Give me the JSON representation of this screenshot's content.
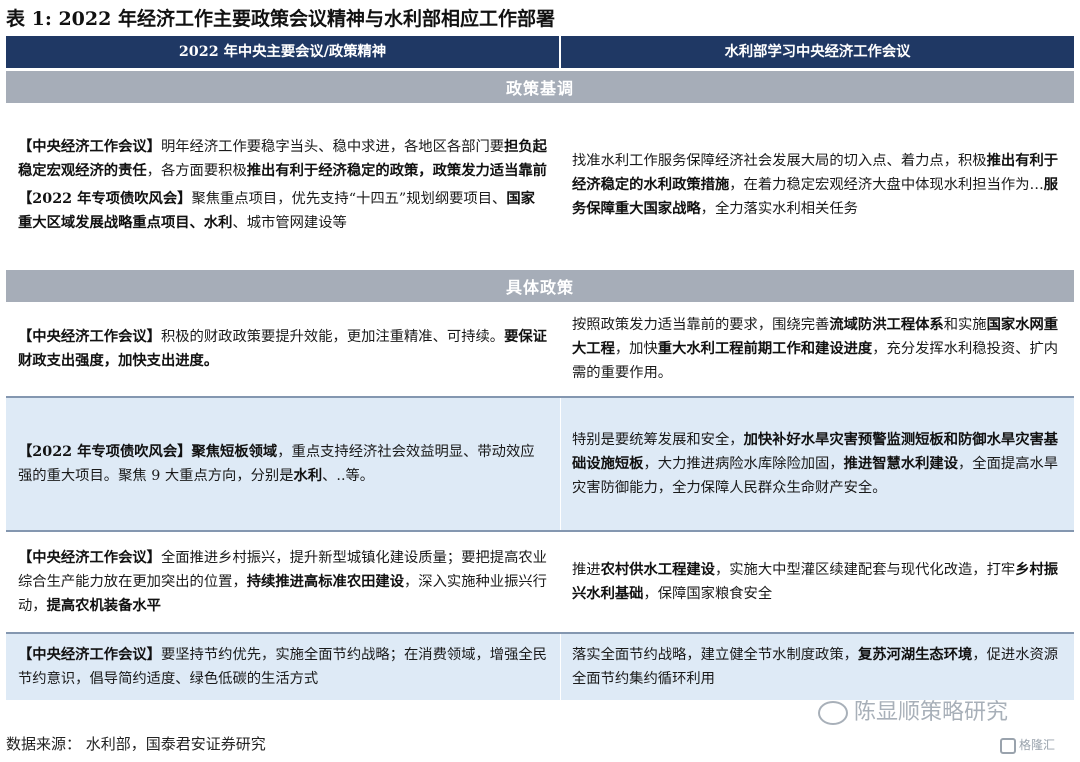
{
  "title": "表 1:  2022 年经济工作主要政策会议精神与水利部相应工作部署",
  "header": {
    "left": "2022 年中央主要会议/政策精神",
    "right": "水利部学习中央经济工作会议"
  },
  "sections": {
    "policy_tone": "政策基调",
    "specific_policy": "具体政策"
  },
  "rows": {
    "r1_left_p1": [
      {
        "t": "【中央经济工作会议】",
        "b": true
      },
      {
        "t": "明年经济工作要稳字当头、稳中求进，各地区各部门要",
        "b": false
      },
      {
        "t": "担负起稳定宏观经济的责任",
        "b": true
      },
      {
        "t": "，各方面要积极",
        "b": false
      },
      {
        "t": "推出有利于经济稳定的政策，政策发力适当靠前",
        "b": true
      }
    ],
    "r1_left_p2": [
      {
        "t": "【2022 年专项债吹风会】",
        "b": true
      },
      {
        "t": "聚焦重点项目，优先支持“十四五”规划纲要项目、",
        "b": false
      },
      {
        "t": "国家重大区域发展战略重点项目、水利",
        "b": true
      },
      {
        "t": "、城市管网建设等",
        "b": false
      }
    ],
    "r1_right": [
      {
        "t": "找准水利工作服务保障经济社会发展大局的切入点、着力点，积极",
        "b": false
      },
      {
        "t": "推出有利于经济稳定的水利政策措施",
        "b": true
      },
      {
        "t": "，在着力稳定宏观经济大盘中体现水利担当作为…",
        "b": false
      },
      {
        "t": "服务保障重大国家战略",
        "b": true
      },
      {
        "t": "，全力落实水利相关任务",
        "b": false
      }
    ],
    "r2_left": [
      {
        "t": "【中央经济工作会议】",
        "b": true
      },
      {
        "t": "积极的财政政策要提升效能，更加注重精准、可持续。",
        "b": false
      },
      {
        "t": "要保证财政支出强度，加快支出进度。",
        "b": true
      }
    ],
    "r2_right": [
      {
        "t": "按照政策发力适当靠前的要求，围绕完善",
        "b": false
      },
      {
        "t": "流域防洪工程体系",
        "b": true
      },
      {
        "t": "和实施",
        "b": false
      },
      {
        "t": "国家水网重大工程",
        "b": true
      },
      {
        "t": "，加快",
        "b": false
      },
      {
        "t": "重大水利工程前期工作和建设进度",
        "b": true
      },
      {
        "t": "，充分发挥水利稳投资、扩内需的重要作用。",
        "b": false
      }
    ],
    "r3_left": [
      {
        "t": "【2022 年专项债吹风会】聚焦短板领域",
        "b": true
      },
      {
        "t": "，重点支持经济社会效益明显、带动效应强的重大项目。聚焦 9 大重点方向，分别是",
        "b": false
      },
      {
        "t": "水利",
        "b": true
      },
      {
        "t": "、..等。",
        "b": false
      }
    ],
    "r3_right": [
      {
        "t": "特别是要统筹发展和安全，",
        "b": false
      },
      {
        "t": "加快补好水旱灾害预警监测短板和防御水旱灾害基础设施短板",
        "b": true
      },
      {
        "t": "，大力推进病险水库除险加固，",
        "b": false
      },
      {
        "t": "推进智慧水利建设",
        "b": true
      },
      {
        "t": "，全面提高水旱灾害防御能力，全力保障人民群众生命财产安全。",
        "b": false
      }
    ],
    "r4_left": [
      {
        "t": "【中央经济工作会议】",
        "b": true
      },
      {
        "t": "全面推进乡村振兴，提升新型城镇化建设质量；要把提高农业综合生产能力放在更加突出的位置，",
        "b": false
      },
      {
        "t": "持续推进高标准农田建设",
        "b": true
      },
      {
        "t": "，深入实施种业振兴行动，",
        "b": false
      },
      {
        "t": "提高农机装备水平",
        "b": true
      }
    ],
    "r4_right": [
      {
        "t": "推进",
        "b": false
      },
      {
        "t": "农村供水工程建设",
        "b": true
      },
      {
        "t": "，实施大中型灌区续建配套与现代化改造，打牢",
        "b": false
      },
      {
        "t": "乡村振兴水利基础",
        "b": true
      },
      {
        "t": "，保障国家粮食安全",
        "b": false
      }
    ],
    "r5_left": [
      {
        "t": "【中央经济工作会议】",
        "b": true
      },
      {
        "t": "要坚持节约优先，实施全面节约战略；在消费领域，增强全民节约意识，倡导简约适度、绿色低碳的生活方式",
        "b": false
      }
    ],
    "r5_right": [
      {
        "t": "落实全面节约战略，建立健全节水制度政策，",
        "b": false
      },
      {
        "t": "复苏河湖生态环境",
        "b": true
      },
      {
        "t": "，促进水资源全面节约集约循环利用",
        "b": false
      }
    ]
  },
  "source": "数据来源：  水利部，国泰君安证券研究",
  "watermark": {
    "main": "陈显顺策略研究",
    "corner": "格隆汇"
  },
  "colors": {
    "header_bg": "#1f3864",
    "section_bg": "#a6adb8",
    "row_blue": "#deeaf6",
    "separator": "#8497b0"
  }
}
